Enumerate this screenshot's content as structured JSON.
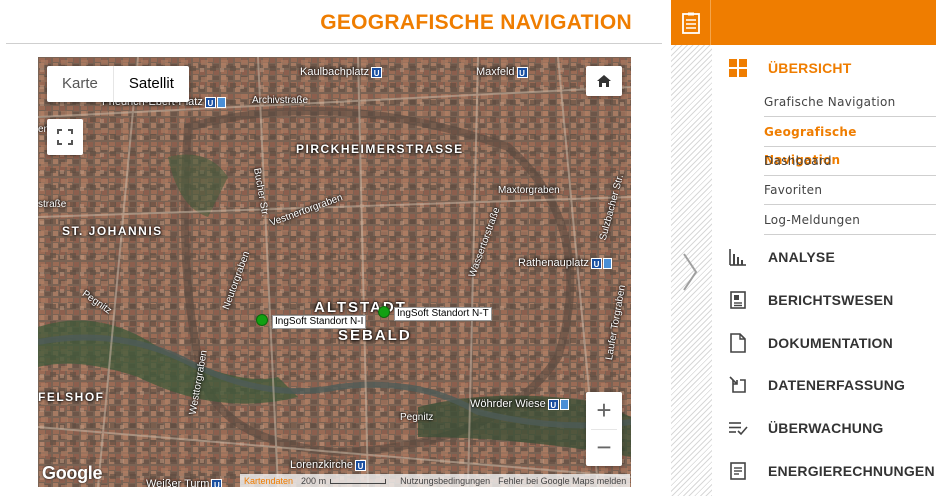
{
  "header": {
    "title": "GEOGRAFISCHE NAVIGATION"
  },
  "map": {
    "maptype_options": [
      "Karte",
      "Satellit"
    ],
    "maptype_selected": "Satellit",
    "zoom_in_label": "+",
    "zoom_out_label": "−",
    "logo_text": "Google",
    "attribution": {
      "kartendaten": "Kartendaten",
      "scale": "200 m",
      "terms": "Nutzungsbedingungen",
      "report": "Fehler bei Google Maps melden"
    },
    "markers": [
      {
        "label": "IngSoft Standort N-I"
      },
      {
        "label": "IngSoft Standort N-T"
      }
    ],
    "place_labels": {
      "kaulbachplatz": "Kaulbachplatz",
      "maxfeld": "Maxfeld",
      "friedrich_ebert_platz": "Friedrich-Ebert-Platz",
      "archivstrasse": "Archivstraße",
      "pirckheimerstrasse": "PIRCKHEIMERSTRASSE",
      "st_johannis": "ST. JOHANNIS",
      "rathenauplatz": "Rathenauplatz",
      "altstadt": "ALTSTADT",
      "sebald": "SEBALD",
      "felshof": "FELSHOF",
      "woehrder_wiese": "Wöhrder Wiese",
      "lorenzkirche": "Lorenzkirche",
      "weisser_turm": "Weißer Turm",
      "pegnitz1": "Pegnitz",
      "pegnitz2": "Pegnitz",
      "bucher_str": "Bucher Str.",
      "vestnertorgraben": "Vestnertorgraben",
      "maxtorgraben": "Maxtorgraben",
      "neutorgraben": "Neutorgraben",
      "westtorgraben": "Westtorgraben",
      "enweg": "enweg",
      "strasse": "straße",
      "laufer_torgraben": "Laufer Torgraben",
      "wassertorstrasse": "Wassertorstraße",
      "sulzbacher_str": "Sulzbacher Str."
    }
  },
  "sidebar": {
    "sections": [
      {
        "label": "ÜBERSICHT",
        "icon": "overview-grid-icon",
        "active": true
      },
      {
        "label": "ANALYSE",
        "icon": "bar-chart-icon"
      },
      {
        "label": "BERICHTSWESEN",
        "icon": "report-icon"
      },
      {
        "label": "DOKUMENTATION",
        "icon": "document-icon"
      },
      {
        "label": "DATENERFASSUNG",
        "icon": "data-entry-icon"
      },
      {
        "label": "ÜBERWACHUNG",
        "icon": "monitoring-check-icon"
      },
      {
        "label": "ENERGIERECHNUNGEN",
        "icon": "invoice-icon"
      }
    ],
    "subitems": [
      {
        "label": "Grafische Navigation"
      },
      {
        "label": "Geografische Navigation",
        "active": true
      },
      {
        "label": "Dashboard"
      },
      {
        "label": "Favoriten"
      },
      {
        "label": "Log-Meldungen"
      }
    ]
  },
  "colors": {
    "accent": "#ef7d00",
    "marker": "#12a012",
    "text": "#333333"
  }
}
